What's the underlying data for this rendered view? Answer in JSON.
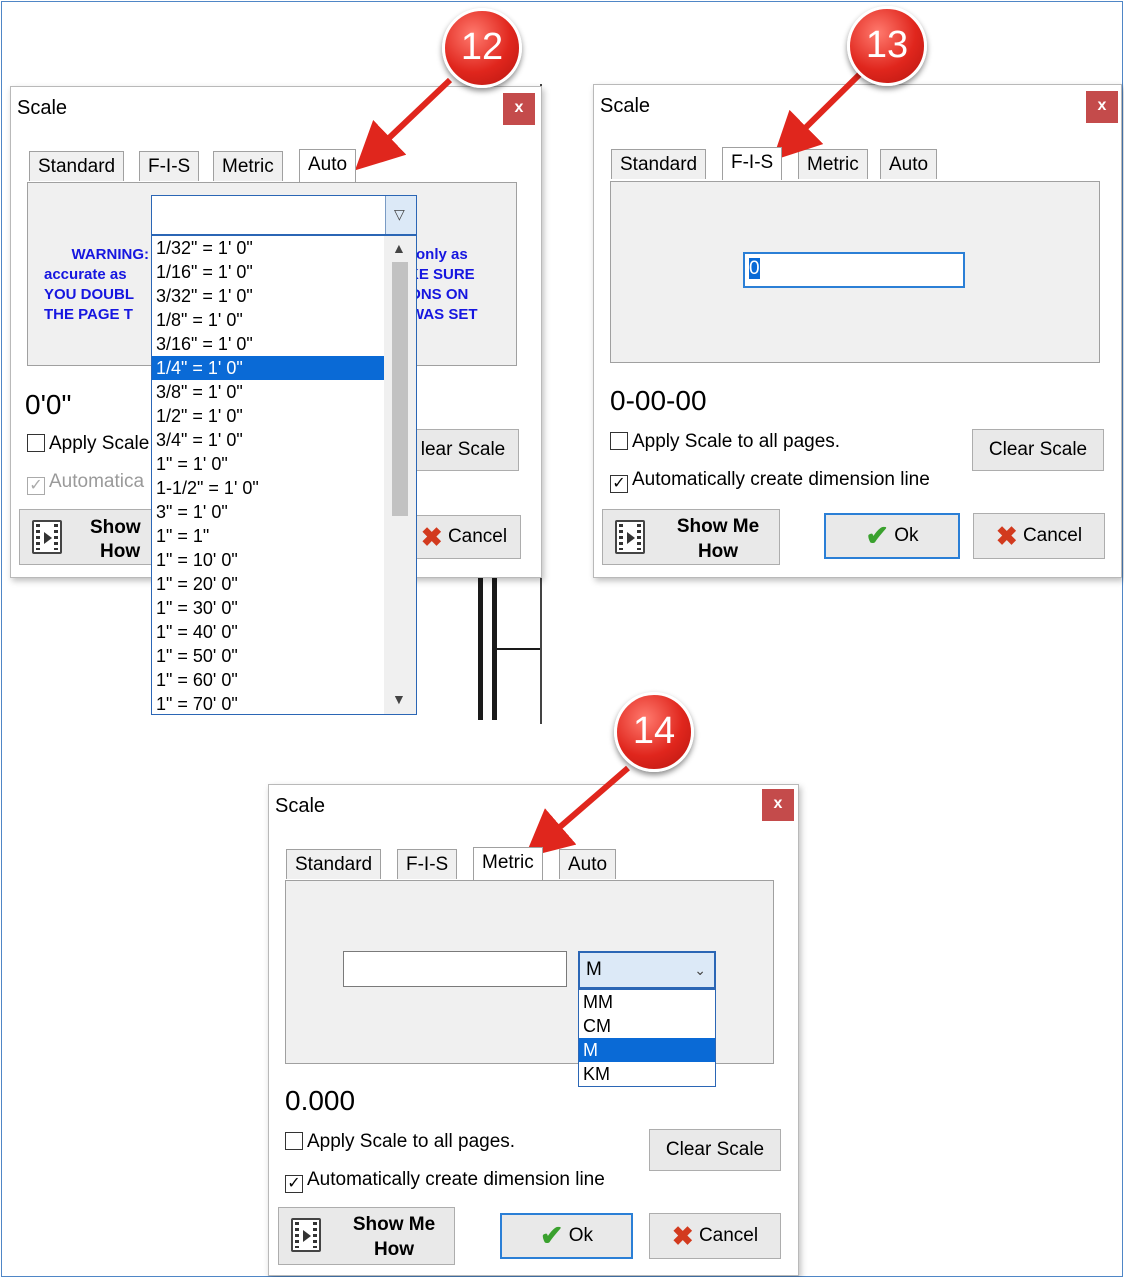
{
  "colors": {
    "accent": "#0a6ad6",
    "warning_text": "#1616e0",
    "badge": "#e0261d",
    "close": "#c44b4b"
  },
  "badges": [
    "12",
    "13",
    "14"
  ],
  "dialog1": {
    "title": "Scale",
    "close": "x",
    "tabs": [
      "Standard",
      "F-I-S",
      "Metric",
      "Auto"
    ],
    "active_tab": "Auto",
    "warning_visible": [
      {
        "left": "WARNING:",
        "right": "only as"
      },
      {
        "left": "accurate as",
        "right": "KE SURE"
      },
      {
        "left": "YOU DOUBL",
        "right": "DNS ON"
      },
      {
        "left": "THE PAGE T",
        "right": "WAS SET"
      }
    ],
    "value": "0'0\"",
    "apply_label": "Apply Scale",
    "auto_label": "Automatica",
    "clear_label": "lear Scale",
    "show_label_1": "Show",
    "show_label_2": "How",
    "cancel_label": "Cancel",
    "dropdown_options": [
      "1/32\" = 1' 0\"",
      "1/16\" = 1' 0\"",
      "3/32\" = 1' 0\"",
      "1/8\" = 1' 0\"",
      "3/16\" = 1' 0\"",
      "1/4\" = 1' 0\"",
      "3/8\" = 1' 0\"",
      "1/2\" = 1' 0\"",
      "3/4\" = 1' 0\"",
      "1\" = 1' 0\"",
      "1-1/2\" = 1' 0\"",
      "3\" = 1' 0\"",
      "1\" = 1\"",
      "1\" = 10' 0\"",
      "1\" = 20' 0\"",
      "1\" = 30' 0\"",
      "1\" = 40' 0\"",
      "1\" = 50' 0\"",
      "1\" = 60' 0\"",
      "1\" = 70' 0\""
    ],
    "selected_option": "1/4\" = 1' 0\""
  },
  "dialog2": {
    "title": "Scale",
    "close": "x",
    "tabs": [
      "Standard",
      "F-I-S",
      "Metric",
      "Auto"
    ],
    "active_tab": "F-I-S",
    "input_value": "0",
    "value": "0-00-00",
    "apply_label": "Apply Scale to all pages.",
    "auto_label": "Automatically create dimension line",
    "apply_checked": false,
    "auto_checked": true,
    "clear_label": "Clear Scale",
    "show_label_1": "Show Me",
    "show_label_2": "How",
    "ok_label": "Ok",
    "cancel_label": "Cancel"
  },
  "dialog3": {
    "title": "Scale",
    "close": "x",
    "tabs": [
      "Standard",
      "F-I-S",
      "Metric",
      "Auto"
    ],
    "active_tab": "Metric",
    "input_value": "",
    "unit_selected": "M",
    "unit_options": [
      "MM",
      "CM",
      "M",
      "KM"
    ],
    "value": "0.000",
    "apply_label": "Apply Scale to all pages.",
    "auto_label": "Automatically create dimension line",
    "apply_checked": false,
    "auto_checked": true,
    "clear_label": "Clear Scale",
    "show_label_1": "Show Me",
    "show_label_2": "How",
    "ok_label": "Ok",
    "cancel_label": "Cancel"
  }
}
